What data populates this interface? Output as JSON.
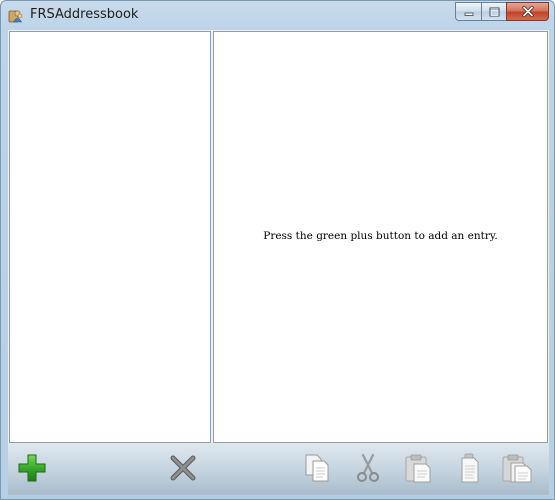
{
  "window": {
    "title": "FRSAddressbook",
    "app_icon": "address-book-icon"
  },
  "caption_buttons": [
    {
      "name": "minimize",
      "icon": "minimize-icon"
    },
    {
      "name": "maximize",
      "icon": "maximize-icon"
    },
    {
      "name": "close",
      "icon": "close-icon"
    }
  ],
  "detail_pane": {
    "empty_message": "Press the green plus button to add an entry."
  },
  "toolbar": {
    "buttons": [
      {
        "name": "add",
        "icon": "plus-icon",
        "color": "#3aa82e"
      },
      {
        "name": "delete",
        "icon": "x-icon",
        "color": "#7d7d7d"
      },
      {
        "name": "copy",
        "icon": "copy-icon"
      },
      {
        "name": "cut",
        "icon": "scissors-icon"
      },
      {
        "name": "paste",
        "icon": "paste-icon"
      },
      {
        "name": "paste-special",
        "icon": "paste-document-icon"
      },
      {
        "name": "paste-all",
        "icon": "paste-multiple-icon"
      }
    ]
  },
  "colors": {
    "accent_green": "#3aa82e",
    "frame": "#bcd3e8",
    "close_button": "#c2432a"
  }
}
